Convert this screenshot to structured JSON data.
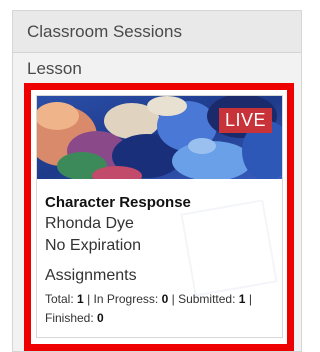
{
  "header": {
    "title": "Classroom Sessions"
  },
  "section": {
    "label": "Lesson"
  },
  "session_card": {
    "badge": "LIVE",
    "title": "Character Response",
    "teacher": "Rhonda Dye",
    "expiration": "No Expiration",
    "assignments_heading": "Assignments",
    "stats": {
      "total_label": "Total:",
      "total_value": "1",
      "in_progress_label": "In Progress:",
      "in_progress_value": "0",
      "submitted_label": "Submitted:",
      "submitted_value": "1",
      "finished_label": "Finished:",
      "finished_value": "0",
      "separator": "|"
    },
    "badge_color": "#c8333a",
    "highlight_color": "#ee0000"
  }
}
